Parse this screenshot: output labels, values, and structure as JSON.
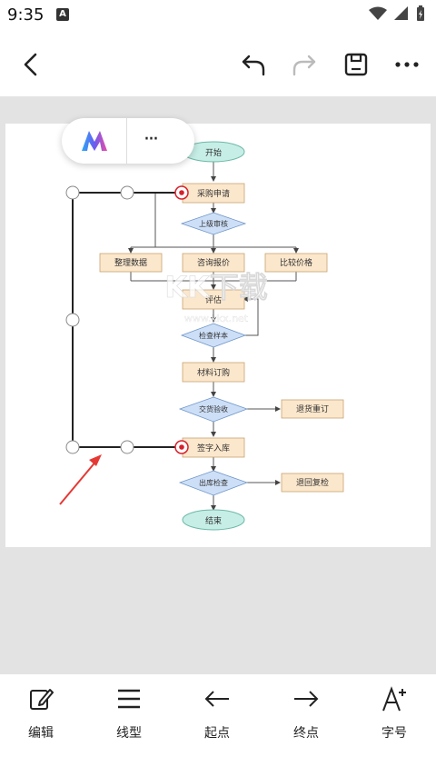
{
  "status_bar": {
    "time": "9:35",
    "notif_icon_letter": "A"
  },
  "toolbar": {
    "back": "back-arrow",
    "undo": "undo-icon",
    "redo": "redo-icon",
    "save": "save-icon",
    "more": "more-icon"
  },
  "float_menu": {
    "more_label": "···"
  },
  "flowchart": {
    "start": "开始",
    "purchase_request": "采购申请",
    "approval": "上级审核",
    "branch_left": "整理数据",
    "branch_mid": "咨询报价",
    "branch_right": "比较价格",
    "evaluate": "评估",
    "inspect_sample": "检查样本",
    "material_order": "材料订购",
    "delivery_check": "交货验收",
    "return_reorder": "退货重订",
    "sign_stock": "签字入库",
    "outbound_check": "出库检查",
    "return_recheck": "退回复检",
    "end": "结束"
  },
  "watermark": {
    "main": "KK下载",
    "url": "www.kkx.net"
  },
  "bottom_tools": [
    {
      "label": "编辑"
    },
    {
      "label": "线型"
    },
    {
      "label": "起点"
    },
    {
      "label": "终点"
    },
    {
      "label": "字号"
    }
  ],
  "colors": {
    "start_end": "#c6eee6",
    "process": "#fbe7cc",
    "decision": "#cddff7",
    "selection": "#d6202a",
    "arrow": "#e53935"
  }
}
